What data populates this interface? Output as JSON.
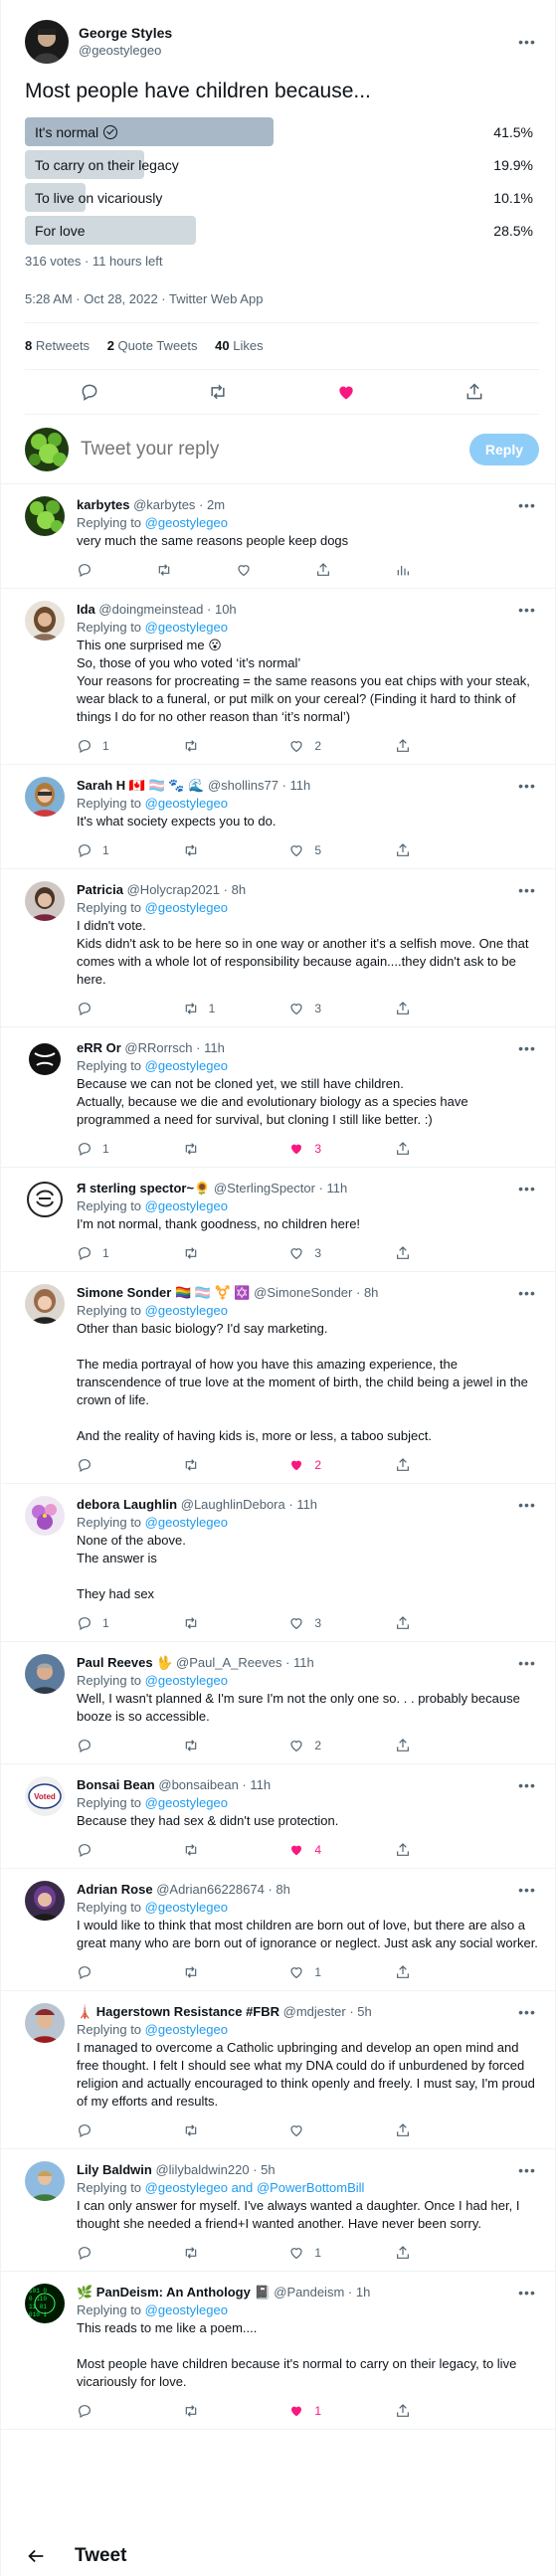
{
  "main": {
    "name": "George Styles",
    "handle": "@geostylegeo",
    "text": "Most people have children because...",
    "poll": {
      "options": [
        {
          "label": "It's normal",
          "percent": "41.5%",
          "value": 41.5,
          "winner": true
        },
        {
          "label": "To carry on their legacy",
          "percent": "19.9%",
          "value": 19.9,
          "winner": false
        },
        {
          "label": "To live on vicariously",
          "percent": "10.1%",
          "value": 10.1,
          "winner": false
        },
        {
          "label": "For love",
          "percent": "28.5%",
          "value": 28.5,
          "winner": false
        }
      ],
      "meta": "316 votes · 11 hours left"
    },
    "timestamp": "5:28 AM · Oct 28, 2022 · Twitter Web App",
    "stats": {
      "retweets_n": "8",
      "retweets_l": "Retweets",
      "quotes_n": "2",
      "quotes_l": "Quote Tweets",
      "likes_n": "40",
      "likes_l": "Likes"
    }
  },
  "reply_box": {
    "placeholder": "Tweet your reply",
    "button": "Reply"
  },
  "colors": {
    "poll_winner": "#a8b8c6",
    "poll_other": "#cfd9de",
    "link": "#1d9bf0",
    "like": "#f91880"
  },
  "replies": [
    {
      "name": "karbytes",
      "handle": "@karbytes",
      "time": "2m",
      "replying_prefix": "Replying to ",
      "mentions": "@geostylegeo",
      "text": "very much the same reasons people keep dogs",
      "replies": "",
      "retweets": "",
      "likes": "",
      "liked": false,
      "analytics": true,
      "avatar": "green"
    },
    {
      "name": "Ida",
      "handle": "@doingmeinstead",
      "time": "10h",
      "replying_prefix": "Replying to ",
      "mentions": "@geostylegeo",
      "text": "This one surprised me 😮\nSo, those of you who voted ‘it’s normal’\nYour reasons for procreating = the same reasons you eat chips with your steak, wear black to a funeral, or put milk on your cereal? (Finding it hard to think of things I do for no other reason than ‘it’s normal’)",
      "replies": "1",
      "retweets": "",
      "likes": "2",
      "liked": false,
      "analytics": false,
      "avatar": "ida"
    },
    {
      "name": "Sarah H 🇨🇦 🏳️‍⚧️ 🐾 🌊",
      "handle": "@shollins77",
      "time": "11h",
      "replying_prefix": "Replying to ",
      "mentions": "@geostylegeo",
      "text": "It's what society expects you to do.",
      "replies": "1",
      "retweets": "",
      "likes": "5",
      "liked": false,
      "analytics": false,
      "avatar": "sarah"
    },
    {
      "name": "Patricia",
      "handle": "@Holycrap2021",
      "time": "8h",
      "replying_prefix": "Replying to ",
      "mentions": "@geostylegeo",
      "text": "I didn't vote.\nKids didn't ask to be here so in one way or another it's a selfish move. One that comes with a whole lot of responsibility because again....they didn't ask to be here.",
      "replies": "",
      "retweets": "1",
      "likes": "3",
      "liked": false,
      "analytics": false,
      "avatar": "patricia"
    },
    {
      "name": "eRR Or",
      "handle": "@RRorrsch",
      "time": "11h",
      "replying_prefix": "Replying to ",
      "mentions": "@geostylegeo",
      "text": "Because we can not be cloned yet, we still have children.\nActually, because we die and evolutionary biology as a species have programmed a need for survival, but cloning I still like better. :)",
      "replies": "1",
      "retweets": "",
      "likes": "3",
      "liked": true,
      "analytics": false,
      "avatar": "err"
    },
    {
      "name": "Я ѕterling ѕpector~🌻",
      "handle": "@SterlingSpector",
      "time": "11h",
      "replying_prefix": "Replying to ",
      "mentions": "@geostylegeo",
      "text": "I'm not normal, thank goodness, no children here!",
      "replies": "1",
      "retweets": "",
      "likes": "3",
      "liked": false,
      "analytics": false,
      "avatar": "sterling"
    },
    {
      "name": "Simone Sonder 🏳️‍🌈 🏳️‍⚧️ ⚧️ ✡️",
      "handle": "@SimoneSonder",
      "time": "8h",
      "replying_prefix": "Replying to ",
      "mentions": "@geostylegeo",
      "text": "Other than basic biology? I'd say marketing.\n\nThe media portrayal of how you have this amazing experience, the transcendence of true love at the moment of birth, the child being a jewel in the crown of life.\n\nAnd the reality of having kids is, more or less, a taboo subject.",
      "replies": "",
      "retweets": "",
      "likes": "2",
      "liked": true,
      "analytics": false,
      "avatar": "simone"
    },
    {
      "name": "debora Laughlin",
      "handle": "@LaughlinDebora",
      "time": "11h",
      "replying_prefix": "Replying to ",
      "mentions": "@geostylegeo",
      "text": "None of the above.\nThe answer is\n\nThey had sex",
      "replies": "1",
      "retweets": "",
      "likes": "3",
      "liked": false,
      "analytics": false,
      "avatar": "debora"
    },
    {
      "name": "Paul Reeves 🖖",
      "handle": "@Paul_A_Reeves",
      "time": "11h",
      "replying_prefix": "Replying to ",
      "mentions": "@geostylegeo",
      "text": "Well, I wasn't planned & I'm sure I'm not the only one so. . . probably because booze is so accessible.",
      "replies": "",
      "retweets": "",
      "likes": "2",
      "liked": false,
      "analytics": false,
      "avatar": "paul"
    },
    {
      "name": "Bonsai Bean",
      "handle": "@bonsaibean",
      "time": "11h",
      "replying_prefix": "Replying to ",
      "mentions": "@geostylegeo",
      "text": "Because they had sex & didn't use protection.",
      "replies": "",
      "retweets": "",
      "likes": "4",
      "liked": true,
      "analytics": false,
      "avatar": "bonsai"
    },
    {
      "name": "Adrian Rose",
      "handle": "@Adrian66228674",
      "time": "8h",
      "replying_prefix": "Replying to ",
      "mentions": "@geostylegeo",
      "text": "I would like to think that most children are born out of love, but there are also a great many who are born out of ignorance or neglect. Just ask any social worker.",
      "replies": "",
      "retweets": "",
      "likes": "1",
      "liked": false,
      "analytics": false,
      "avatar": "adrian"
    },
    {
      "name": "🗼 Hagerstown Resistance #FBR",
      "handle": "@mdjester",
      "time": "5h",
      "replying_prefix": "Replying to ",
      "mentions": "@geostylegeo",
      "text": "I managed to overcome a Catholic upbringing and develop an open mind and free thought. I felt I should see what my DNA could do if unburdened by forced religion and actually encouraged to think openly and freely. I must say, I'm proud of my efforts and results.",
      "replies": "",
      "retweets": "",
      "likes": "",
      "liked": false,
      "analytics": false,
      "avatar": "hager"
    },
    {
      "name": "Lily Baldwin",
      "handle": "@lilybaldwin220",
      "time": "5h",
      "replying_prefix": "Replying to ",
      "mentions": "@geostylegeo and @PowerBottomBill",
      "text": "I can only answer for myself. I've always wanted a daughter. Once I had her, I thought she needed a friend+I wanted another. Have never been sorry.",
      "replies": "",
      "retweets": "",
      "likes": "1",
      "liked": false,
      "analytics": false,
      "avatar": "lily"
    },
    {
      "name": "🌿 PanDeism: An Anthology 📓",
      "handle": "@Pandeism",
      "time": "1h",
      "replying_prefix": "Replying to ",
      "mentions": "@geostylegeo",
      "text": "This reads to me like a poem....\n\nMost people have children because it's normal to carry on their legacy, to live vicariously for love.",
      "replies": "",
      "retweets": "",
      "likes": "1",
      "liked": true,
      "analytics": false,
      "avatar": "pandeism"
    }
  ],
  "bottom_bar": {
    "title": "Tweet"
  }
}
